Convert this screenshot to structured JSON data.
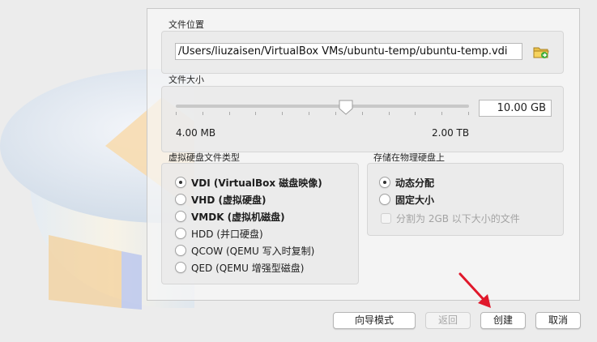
{
  "file_location": {
    "label": "文件位置",
    "path_value": "/Users/liuzaisen/VirtualBox VMs/ubuntu-temp/ubuntu-temp.vdi",
    "folder_icon": "folder-browse-icon"
  },
  "file_size": {
    "label": "文件大小",
    "value": "10.00 GB",
    "min_label": "4.00 MB",
    "max_label": "2.00 TB",
    "slider_fraction": 0.58
  },
  "disk_type": {
    "label": "虚拟硬盘文件类型",
    "options": [
      {
        "label": "VDI (VirtualBox 磁盘映像)",
        "checked": true
      },
      {
        "label": "VHD (虚拟硬盘)",
        "checked": false
      },
      {
        "label": "VMDK (虚拟机磁盘)",
        "checked": false
      },
      {
        "label": "HDD (并口硬盘)",
        "checked": false
      },
      {
        "label": "QCOW (QEMU 写入时复制)",
        "checked": false
      },
      {
        "label": "QED (QEMU 增强型磁盘)",
        "checked": false
      }
    ]
  },
  "storage": {
    "label": "存储在物理硬盘上",
    "options": [
      {
        "label": "动态分配",
        "checked": true
      },
      {
        "label": "固定大小",
        "checked": false
      }
    ],
    "split_label": "分割为 2GB 以下大小的文件"
  },
  "buttons": {
    "guided_mode": "向导模式",
    "back": "返回",
    "create": "创建",
    "cancel": "取消"
  },
  "colors": {
    "annotation_arrow": "#e0182b"
  }
}
